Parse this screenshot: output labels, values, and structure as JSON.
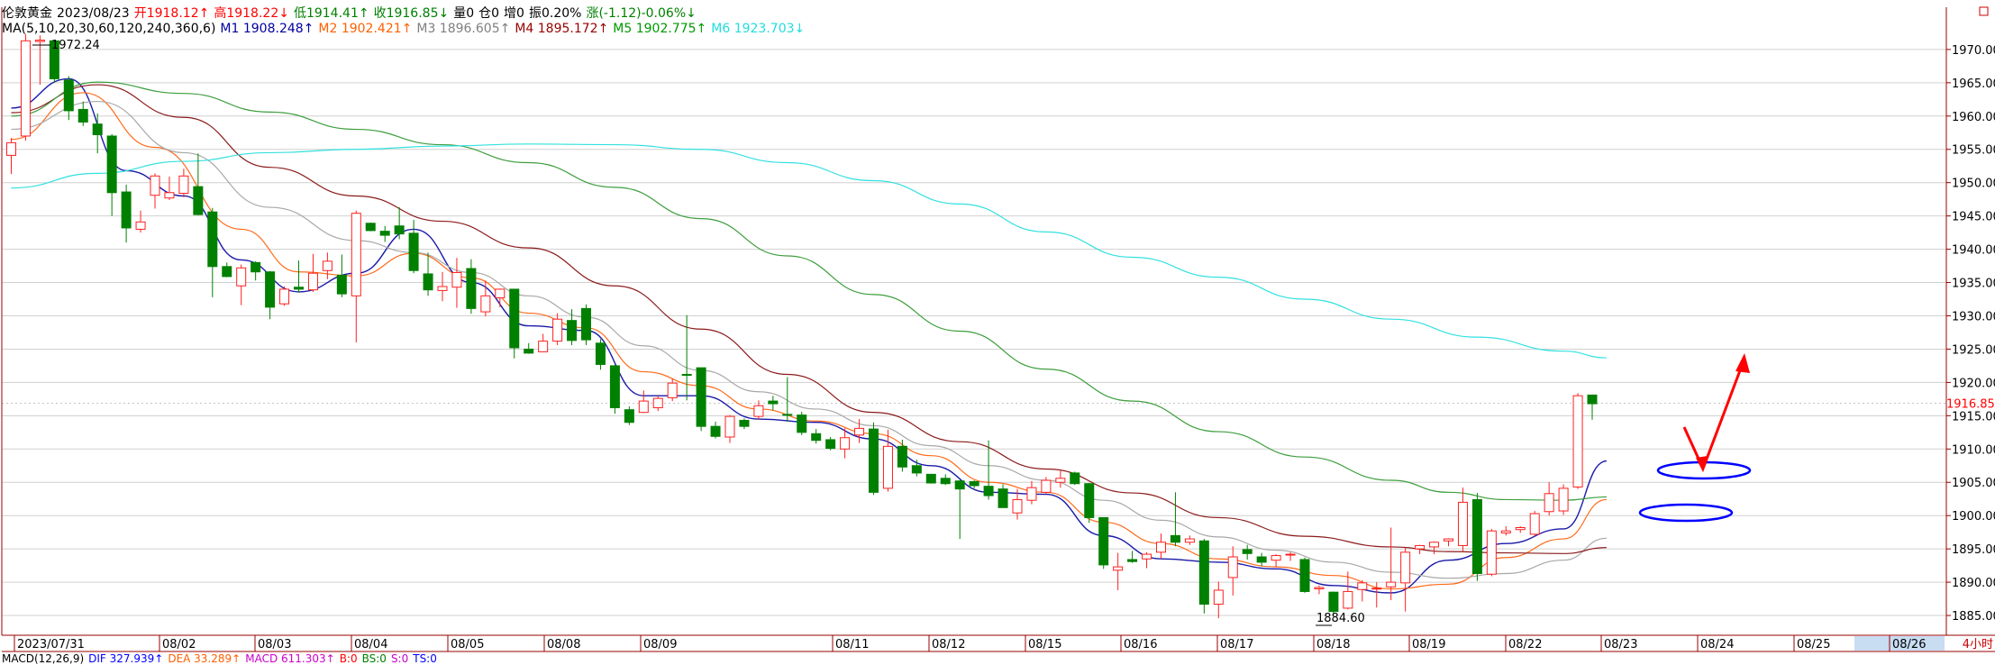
{
  "header": {
    "symbol": "伦敦黄金",
    "date": "2023/08/23",
    "open": "开1918.12↑",
    "high": "高1918.22↓",
    "low": "低1914.41↑",
    "close": "收1916.85↓",
    "volume": "量0",
    "position": "仓0",
    "increase": "增0",
    "amplitude": "振0.20%",
    "change": "涨(-1.12)-0.06%↓"
  },
  "ma_header": {
    "label": "MA(5,10,20,30,60,120,240,360,6)",
    "m1": "M1 1908.248↑",
    "m2": "M2 1902.421↑",
    "m3": "M3 1896.605↑",
    "m4": "M4 1895.172↑",
    "m5": "M5 1902.775↑",
    "m6": "M6 1923.703↓"
  },
  "macd_header": {
    "label": "MACD(12,26,9)",
    "dif": "DIF 327.939↑",
    "dea": "DEA 33.289↑",
    "macd": "MACD 611.303↑",
    "b": "B:0",
    "bs": "BS:0",
    "s": "S:0",
    "ts": "TS:0"
  },
  "price_tag": "1916.85",
  "period": "4小时",
  "colors": {
    "up": "#ff2020",
    "down": "#008000",
    "m1": "#1a1aaa",
    "m2": "#ff6a1a",
    "m3": "#a8a8a8",
    "m4": "#8b1a1a",
    "m5": "#3d9e3d",
    "m6": "#33e0e0",
    "annotation": "#0000ff",
    "arrow": "#ff0000",
    "grid": "#d0d0d0"
  },
  "chart_data": {
    "type": "candlestick",
    "yticks": [
      1885,
      1890,
      1895,
      1900,
      1905,
      1910,
      1915,
      1920,
      1925,
      1930,
      1935,
      1940,
      1945,
      1950,
      1955,
      1960,
      1965,
      1970
    ],
    "ylim": [
      1882.3,
      1974.1
    ],
    "xticks": [
      "2023/07/31",
      "08/02",
      "08/03",
      "08/04",
      "08/05",
      "08/08",
      "08/09",
      "08/11",
      "08/12",
      "08/15",
      "08/16",
      "08/17",
      "08/18",
      "08/19",
      "08/22",
      "08/23",
      "08/24",
      "08/25",
      "08/26"
    ],
    "annotations": {
      "high_label": "1972.24",
      "low_label": "1884.60"
    },
    "candles": [
      [
        1954.1,
        1956.7,
        1951.3,
        1956.0
      ],
      [
        1957.0,
        1972.3,
        1956.3,
        1971.3
      ],
      [
        1971.2,
        1972.1,
        1964.7,
        1971.4
      ],
      [
        1971.3,
        1971.4,
        1965.0,
        1965.6
      ],
      [
        1965.4,
        1966.0,
        1959.4,
        1960.8
      ],
      [
        1961.0,
        1962.2,
        1958.5,
        1959.1
      ],
      [
        1958.8,
        1960.4,
        1954.4,
        1957.2
      ],
      [
        1957.0,
        1957.3,
        1945.0,
        1948.5
      ],
      [
        1948.6,
        1949.7,
        1941.0,
        1943.2
      ],
      [
        1943.0,
        1945.8,
        1942.5,
        1944.1
      ],
      [
        1948.1,
        1951.4,
        1946.1,
        1951.0
      ],
      [
        1947.7,
        1950.9,
        1947.4,
        1948.5
      ],
      [
        1948.4,
        1952.1,
        1947.8,
        1951.0
      ],
      [
        1949.4,
        1954.4,
        1945.1,
        1945.2
      ],
      [
        1945.6,
        1946.2,
        1932.8,
        1937.4
      ],
      [
        1937.4,
        1938.0,
        1935.8,
        1935.9
      ],
      [
        1934.5,
        1937.7,
        1931.6,
        1937.2
      ],
      [
        1938.0,
        1938.2,
        1935.3,
        1936.6
      ],
      [
        1936.6,
        1936.7,
        1929.5,
        1931.3
      ],
      [
        1931.8,
        1934.4,
        1931.5,
        1934.0
      ],
      [
        1934.3,
        1938.3,
        1933.5,
        1934.0
      ],
      [
        1933.9,
        1939.3,
        1933.6,
        1936.4
      ],
      [
        1936.8,
        1939.5,
        1935.5,
        1938.2
      ],
      [
        1936.1,
        1939.2,
        1932.8,
        1933.3
      ],
      [
        1933.0,
        1945.8,
        1926.0,
        1945.4
      ],
      [
        1943.9,
        1944.0,
        1942.7,
        1942.8
      ],
      [
        1942.7,
        1943.5,
        1941.1,
        1942.1
      ],
      [
        1943.5,
        1946.3,
        1941.5,
        1942.3
      ],
      [
        1942.4,
        1944.4,
        1936.4,
        1936.8
      ],
      [
        1936.3,
        1939.5,
        1933.0,
        1933.9
      ],
      [
        1933.8,
        1936.6,
        1932.2,
        1934.4
      ],
      [
        1934.3,
        1938.7,
        1931.2,
        1936.5
      ],
      [
        1937.1,
        1938.5,
        1930.3,
        1931.1
      ],
      [
        1930.6,
        1935.3,
        1929.9,
        1933.0
      ],
      [
        1932.7,
        1934.1,
        1931.3,
        1934.0
      ],
      [
        1934.0,
        1934.0,
        1923.6,
        1925.2
      ],
      [
        1925.0,
        1925.9,
        1924.3,
        1924.4
      ],
      [
        1924.6,
        1927.3,
        1924.6,
        1926.2
      ],
      [
        1926.2,
        1930.4,
        1925.6,
        1929.5
      ],
      [
        1929.3,
        1931.0,
        1925.6,
        1926.3
      ],
      [
        1931.1,
        1931.7,
        1925.6,
        1926.4
      ],
      [
        1925.9,
        1926.5,
        1921.9,
        1922.7
      ],
      [
        1922.5,
        1922.6,
        1915.3,
        1916.2
      ],
      [
        1915.9,
        1916.4,
        1913.6,
        1914.0
      ],
      [
        1915.5,
        1918.8,
        1915.4,
        1917.2
      ],
      [
        1916.2,
        1918.0,
        1915.7,
        1917.6
      ],
      [
        1917.7,
        1920.6,
        1917.2,
        1919.9
      ],
      [
        1921.2,
        1930.1,
        1917.3,
        1921.1
      ],
      [
        1922.2,
        1922.2,
        1912.7,
        1913.4
      ],
      [
        1913.4,
        1914.1,
        1911.6,
        1911.9
      ],
      [
        1911.8,
        1915.1,
        1910.9,
        1914.9
      ],
      [
        1914.3,
        1914.6,
        1913.0,
        1913.4
      ],
      [
        1914.9,
        1917.3,
        1914.4,
        1916.5
      ],
      [
        1917.2,
        1918.0,
        1915.8,
        1916.8
      ],
      [
        1915.2,
        1920.8,
        1914.1,
        1915.1
      ],
      [
        1915.1,
        1915.6,
        1912.1,
        1912.5
      ],
      [
        1912.3,
        1913.0,
        1910.8,
        1911.3
      ],
      [
        1911.4,
        1911.8,
        1909.8,
        1910.1
      ],
      [
        1910.0,
        1913.1,
        1908.6,
        1911.7
      ],
      [
        1912.1,
        1914.5,
        1910.9,
        1913.1
      ],
      [
        1913.0,
        1914.0,
        1903.1,
        1903.5
      ],
      [
        1904.1,
        1912.9,
        1903.6,
        1910.4
      ],
      [
        1910.4,
        1911.4,
        1906.6,
        1907.3
      ],
      [
        1907.5,
        1908.4,
        1905.9,
        1906.4
      ],
      [
        1906.2,
        1906.2,
        1904.8,
        1904.9
      ],
      [
        1905.6,
        1906.2,
        1904.6,
        1904.8
      ],
      [
        1905.2,
        1905.3,
        1896.5,
        1904.0
      ],
      [
        1905.1,
        1905.3,
        1904.1,
        1904.5
      ],
      [
        1904.4,
        1911.3,
        1902.4,
        1903.0
      ],
      [
        1904.0,
        1904.7,
        1901.2,
        1901.2
      ],
      [
        1900.4,
        1904.0,
        1899.4,
        1902.4
      ],
      [
        1902.3,
        1905.2,
        1901.7,
        1904.2
      ],
      [
        1903.5,
        1905.8,
        1903.2,
        1905.3
      ],
      [
        1905.0,
        1906.9,
        1904.2,
        1905.6
      ],
      [
        1906.4,
        1906.6,
        1904.6,
        1904.8
      ],
      [
        1904.8,
        1904.9,
        1898.9,
        1899.7
      ],
      [
        1899.7,
        1899.7,
        1892.0,
        1892.6
      ],
      [
        1891.8,
        1894.4,
        1888.8,
        1892.3
      ],
      [
        1893.4,
        1894.7,
        1892.9,
        1893.1
      ],
      [
        1893.5,
        1894.5,
        1892.1,
        1894.2
      ],
      [
        1894.5,
        1897.3,
        1893.5,
        1896.0
      ],
      [
        1897.0,
        1903.5,
        1895.4,
        1896.0
      ],
      [
        1896.0,
        1897.0,
        1895.6,
        1896.5
      ],
      [
        1896.2,
        1896.5,
        1885.3,
        1886.7
      ],
      [
        1886.7,
        1890.1,
        1884.6,
        1888.8
      ],
      [
        1890.7,
        1895.4,
        1888.0,
        1893.8
      ],
      [
        1894.9,
        1895.6,
        1893.4,
        1894.3
      ],
      [
        1893.8,
        1894.4,
        1892.4,
        1893.0
      ],
      [
        1893.3,
        1894.2,
        1892.3,
        1894.0
      ],
      [
        1894.1,
        1894.5,
        1893.2,
        1894.2
      ],
      [
        1893.4,
        1893.7,
        1888.4,
        1888.6
      ],
      [
        1889.0,
        1889.5,
        1888.2,
        1889.2
      ],
      [
        1888.5,
        1888.6,
        1885.2,
        1885.6
      ],
      [
        1886.1,
        1891.6,
        1885.9,
        1888.6
      ],
      [
        1888.9,
        1890.3,
        1887.1,
        1889.9
      ],
      [
        1889.1,
        1890.0,
        1886.2,
        1889.1
      ],
      [
        1889.3,
        1898.2,
        1887.3,
        1890.0
      ],
      [
        1889.9,
        1895.2,
        1885.6,
        1894.5
      ],
      [
        1895.0,
        1895.6,
        1894.2,
        1895.5
      ],
      [
        1895.3,
        1896.1,
        1894.2,
        1896.0
      ],
      [
        1896.2,
        1896.6,
        1895.4,
        1896.5
      ],
      [
        1895.5,
        1904.2,
        1894.6,
        1902.0
      ],
      [
        1902.4,
        1903.4,
        1890.2,
        1891.3
      ],
      [
        1891.2,
        1898.0,
        1890.9,
        1897.7
      ],
      [
        1897.4,
        1898.4,
        1897.0,
        1897.7
      ],
      [
        1897.9,
        1898.4,
        1897.4,
        1898.2
      ],
      [
        1897.2,
        1900.7,
        1896.9,
        1900.3
      ],
      [
        1900.6,
        1905.0,
        1900.0,
        1903.3
      ],
      [
        1900.7,
        1904.7,
        1900.1,
        1904.1
      ],
      [
        1904.3,
        1918.4,
        1904.0,
        1918.0
      ],
      [
        1918.1,
        1918.2,
        1914.4,
        1916.8
      ]
    ],
    "moving_averages": [
      {
        "name": "M1",
        "values": [
          [
            0,
            1961.2
          ],
          [
            4,
            1965.6
          ],
          [
            8,
            1951.8
          ],
          [
            12,
            1948.0
          ],
          [
            16,
            1938.4
          ],
          [
            20,
            1933.6
          ],
          [
            24,
            1936.4
          ],
          [
            28,
            1943.0
          ],
          [
            32,
            1935.0
          ],
          [
            36,
            1928.5
          ],
          [
            40,
            1927.8
          ],
          [
            44,
            1918.0
          ],
          [
            48,
            1918.0
          ],
          [
            52,
            1914.5
          ],
          [
            56,
            1914.0
          ],
          [
            60,
            1911.5
          ],
          [
            64,
            1907.5
          ],
          [
            68,
            1903.5
          ],
          [
            72,
            1903.2
          ],
          [
            76,
            1897.0
          ],
          [
            80,
            1893.5
          ],
          [
            84,
            1893.0
          ],
          [
            88,
            1892.0
          ],
          [
            92,
            1889.5
          ],
          [
            96,
            1888.4
          ],
          [
            100,
            1893.3
          ],
          [
            104,
            1895.8
          ],
          [
            108,
            1898.0
          ],
          [
            111,
            1908.2
          ]
        ]
      },
      {
        "name": "M2",
        "values": [
          [
            0,
            1956.5
          ],
          [
            5,
            1963.5
          ],
          [
            10,
            1955.3
          ],
          [
            16,
            1943.0
          ],
          [
            20,
            1936.6
          ],
          [
            24,
            1936.0
          ],
          [
            28,
            1939.4
          ],
          [
            32,
            1935.7
          ],
          [
            36,
            1930.4
          ],
          [
            40,
            1928.2
          ],
          [
            44,
            1921.6
          ],
          [
            48,
            1919.5
          ],
          [
            52,
            1916.0
          ],
          [
            56,
            1914.2
          ],
          [
            60,
            1912.3
          ],
          [
            64,
            1909.0
          ],
          [
            68,
            1905.0
          ],
          [
            72,
            1903.5
          ],
          [
            76,
            1899.0
          ],
          [
            80,
            1895.8
          ],
          [
            84,
            1893.5
          ],
          [
            88,
            1892.3
          ],
          [
            92,
            1891.0
          ],
          [
            96,
            1889.0
          ],
          [
            100,
            1889.7
          ],
          [
            104,
            1893.7
          ],
          [
            108,
            1896.5
          ],
          [
            111,
            1902.4
          ]
        ]
      },
      {
        "name": "M3",
        "values": [
          [
            0,
            1958.0
          ],
          [
            6,
            1962.2
          ],
          [
            12,
            1954.5
          ],
          [
            18,
            1946.3
          ],
          [
            24,
            1941.3
          ],
          [
            28,
            1939.5
          ],
          [
            32,
            1936.5
          ],
          [
            36,
            1933.0
          ],
          [
            40,
            1929.8
          ],
          [
            44,
            1925.5
          ],
          [
            48,
            1921.8
          ],
          [
            52,
            1918.6
          ],
          [
            56,
            1916.0
          ],
          [
            60,
            1913.5
          ],
          [
            64,
            1910.5
          ],
          [
            68,
            1907.5
          ],
          [
            72,
            1905.3
          ],
          [
            76,
            1902.3
          ],
          [
            80,
            1899.3
          ],
          [
            84,
            1896.8
          ],
          [
            88,
            1894.8
          ],
          [
            92,
            1893.0
          ],
          [
            96,
            1891.5
          ],
          [
            100,
            1890.6
          ],
          [
            104,
            1891.3
          ],
          [
            108,
            1893.3
          ],
          [
            111,
            1896.6
          ]
        ]
      },
      {
        "name": "M4",
        "values": [
          [
            0,
            1960.5
          ],
          [
            6,
            1964.7
          ],
          [
            12,
            1959.8
          ],
          [
            18,
            1952.3
          ],
          [
            24,
            1948.0
          ],
          [
            30,
            1944.2
          ],
          [
            36,
            1940.2
          ],
          [
            42,
            1934.5
          ],
          [
            48,
            1928.0
          ],
          [
            54,
            1921.2
          ],
          [
            60,
            1915.5
          ],
          [
            66,
            1911.1
          ],
          [
            72,
            1907.0
          ],
          [
            78,
            1903.4
          ],
          [
            84,
            1899.7
          ],
          [
            90,
            1896.9
          ],
          [
            96,
            1895.3
          ],
          [
            100,
            1894.6
          ],
          [
            104,
            1894.4
          ],
          [
            108,
            1894.3
          ],
          [
            111,
            1895.2
          ]
        ]
      },
      {
        "name": "M5",
        "values": [
          [
            0,
            1960.0
          ],
          [
            6,
            1965.1
          ],
          [
            12,
            1963.4
          ],
          [
            18,
            1960.6
          ],
          [
            24,
            1958.0
          ],
          [
            30,
            1955.7
          ],
          [
            36,
            1953.0
          ],
          [
            42,
            1949.3
          ],
          [
            48,
            1944.6
          ],
          [
            54,
            1939.0
          ],
          [
            60,
            1933.2
          ],
          [
            66,
            1927.7
          ],
          [
            72,
            1922.0
          ],
          [
            78,
            1917.2
          ],
          [
            84,
            1912.6
          ],
          [
            90,
            1908.8
          ],
          [
            96,
            1905.3
          ],
          [
            100,
            1903.5
          ],
          [
            104,
            1902.4
          ],
          [
            108,
            1902.3
          ],
          [
            111,
            1902.8
          ]
        ]
      },
      {
        "name": "M6",
        "values": [
          [
            0,
            1949.2
          ],
          [
            6,
            1951.4
          ],
          [
            12,
            1953.2
          ],
          [
            18,
            1954.5
          ],
          [
            24,
            1955.0
          ],
          [
            30,
            1955.5
          ],
          [
            36,
            1955.8
          ],
          [
            42,
            1955.7
          ],
          [
            48,
            1955.0
          ],
          [
            54,
            1953.0
          ],
          [
            60,
            1950.3
          ],
          [
            66,
            1946.8
          ],
          [
            72,
            1942.6
          ],
          [
            78,
            1938.8
          ],
          [
            84,
            1935.8
          ],
          [
            90,
            1932.5
          ],
          [
            96,
            1929.5
          ],
          [
            102,
            1926.8
          ],
          [
            108,
            1924.7
          ],
          [
            111,
            1923.7
          ]
        ]
      }
    ]
  }
}
